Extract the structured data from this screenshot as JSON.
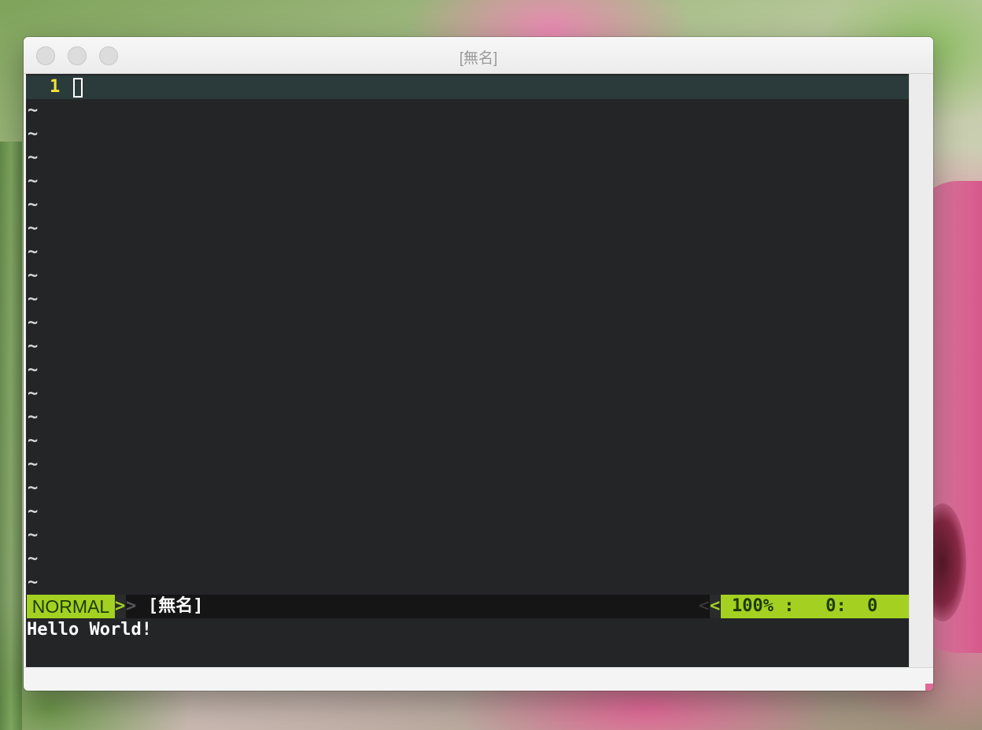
{
  "window": {
    "title": "[無名]"
  },
  "editor": {
    "current_line_number": "1",
    "tilde": "~",
    "tilde_count": 21
  },
  "statusline": {
    "mode": "NORMAL",
    "right_arrow": ">",
    "left_arrow": "<",
    "filename": "[無名]",
    "position": "100% :   0:  0"
  },
  "cmdline": {
    "message": "Hello World!"
  },
  "colors": {
    "mode_background": "#a4d121",
    "editor_background": "#242527",
    "line_number": "#f2e23a"
  }
}
